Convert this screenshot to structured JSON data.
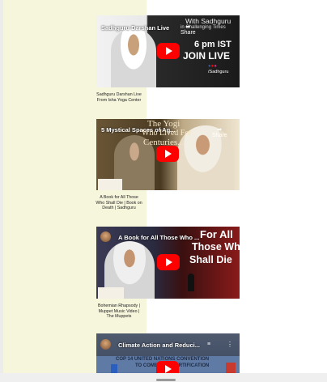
{
  "videos": [
    {
      "overlay_title": "Sadhguru Darshan Live",
      "caption": "Sadhguru Darshan Live From Isha Yoga Center",
      "thumb_text_1": "With Sadhguru",
      "thumb_text_2": "in Challenging Times",
      "thumb_text_3": "6 pm IST",
      "thumb_text_4": "JOIN LIVE",
      "thumb_text_5": "/Sadhguru",
      "share_label": "Share"
    },
    {
      "overlay_title": "5 Mystical Spaces of Ag...",
      "caption": "A Book for All Those Who Shall Die | Book on Death | Sadhguru",
      "thumb_text_1": "The Yogi",
      "thumb_text_2": "Who Lived For",
      "thumb_text_3": "Centuries...",
      "share_label": "Share"
    },
    {
      "overlay_title": "A Book for All Those Who ...",
      "caption": "Bohemian Rhapsody | Muppet Music Video | The Muppets",
      "thumb_text_1": "For All",
      "thumb_text_2": "Those Who",
      "thumb_text_3": "Shall Die"
    },
    {
      "overlay_title": "Climate Action and Reduci...",
      "thumb_text_1": "COP 14 UNITED NATIONS CONVENTION",
      "thumb_text_2": "TO COMBAT DESERTIFICATION"
    }
  ],
  "colors": {
    "panel": "#f6f6dc",
    "play": "#ff0000"
  }
}
